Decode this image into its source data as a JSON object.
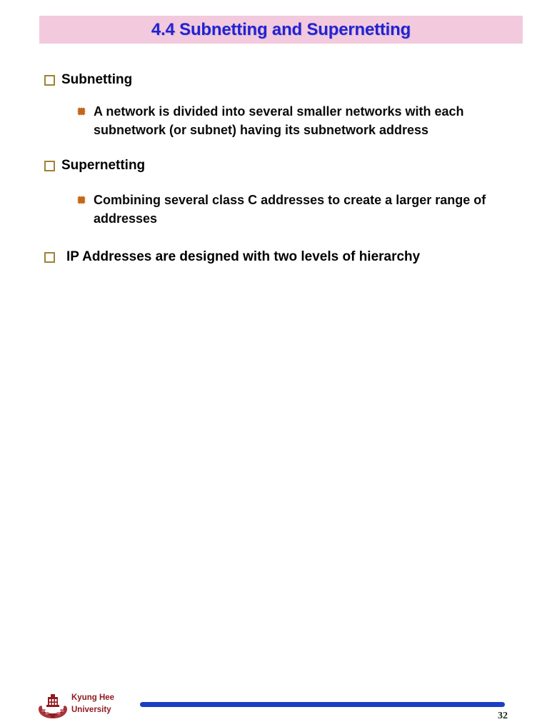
{
  "slide": {
    "title": "4.4 Subnetting and Supernetting",
    "title_background_color": "#f3c9dd",
    "title_text_color": "#2323cf",
    "square_bullet_color": "#9d8334",
    "diamond_bullet_color": "#c4661a",
    "bullets": [
      {
        "level": 1,
        "marker": "square-bullet",
        "text": "Subnetting"
      },
      {
        "level": 2,
        "marker": "diamond-bullet",
        "text": "A network is divided into several smaller networks with each subnetwork (or subnet) having its subnetwork address"
      },
      {
        "level": 1,
        "marker": "square-bullet",
        "text": "Supernetting"
      },
      {
        "level": 2,
        "marker": "diamond-bullet",
        "text": "Combining several class C addresses to create a larger range of addresses"
      },
      {
        "level": 1,
        "marker": "square-bullet",
        "text": "IP Addresses are designed with two levels of hierarchy"
      }
    ]
  },
  "footer": {
    "logo_name": "kyung-hee-university-crest",
    "logo_color": "#8f1b22",
    "organization_line1": "Kyung Hee",
    "organization_line2": "University",
    "rule_color": "#1a3fc4",
    "page_number": "32"
  }
}
